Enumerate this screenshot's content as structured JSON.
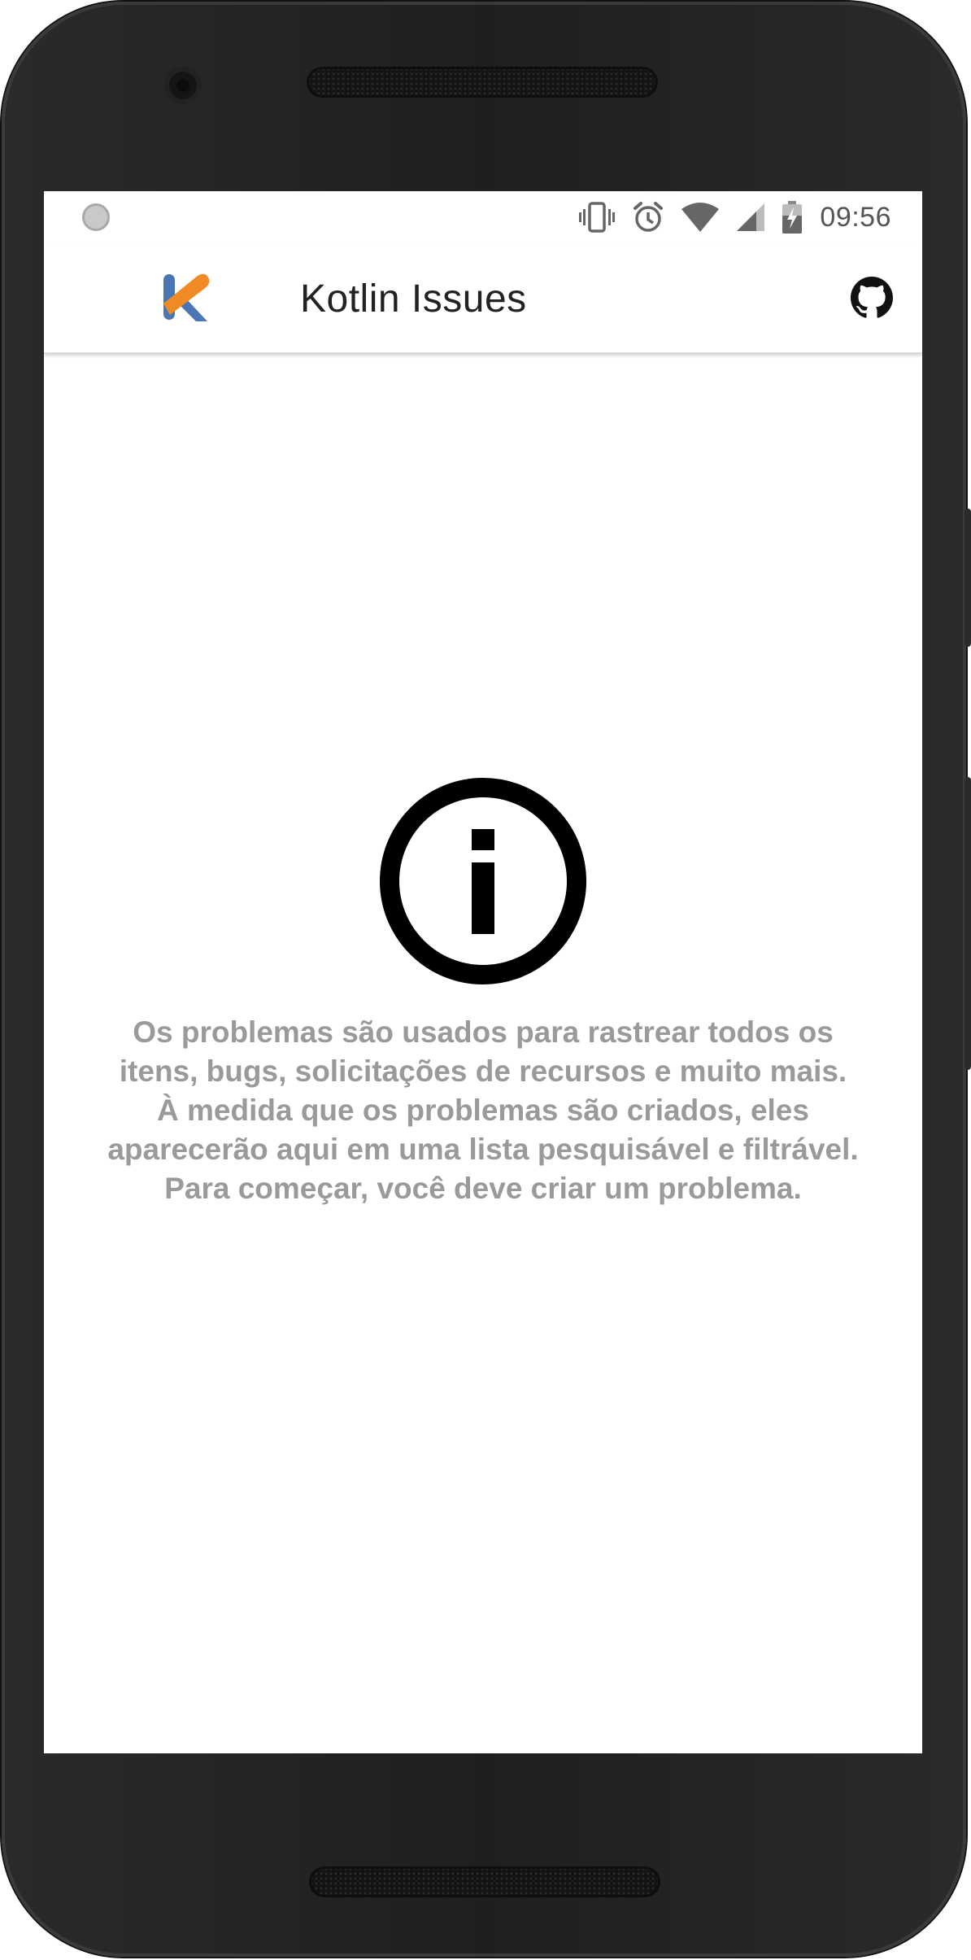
{
  "status_bar": {
    "time": "09:56",
    "icons": [
      "notification-dot-icon",
      "vibrate-icon",
      "alarm-icon",
      "wifi-icon",
      "signal-icon",
      "battery-charging-icon"
    ]
  },
  "app_bar": {
    "title": "Kotlin Issues",
    "logo_icon": "kotlin-logo-icon",
    "action_icon": "github-icon"
  },
  "empty_state": {
    "icon": "info-icon",
    "lines": [
      "Os problemas são usados para rastrear todos os",
      "itens, bugs, solicitações de recursos e muito mais.",
      "À medida que os problemas são criados, eles",
      "aparecerão aqui em uma lista pesquisável e filtrável.",
      "Para começar, você deve criar um problema."
    ]
  },
  "colors": {
    "kotlin_orange": "#F08A24",
    "kotlin_blue": "#4A77B4",
    "text_gray": "#9A9A9A",
    "device_body": "#1F1F1F"
  }
}
